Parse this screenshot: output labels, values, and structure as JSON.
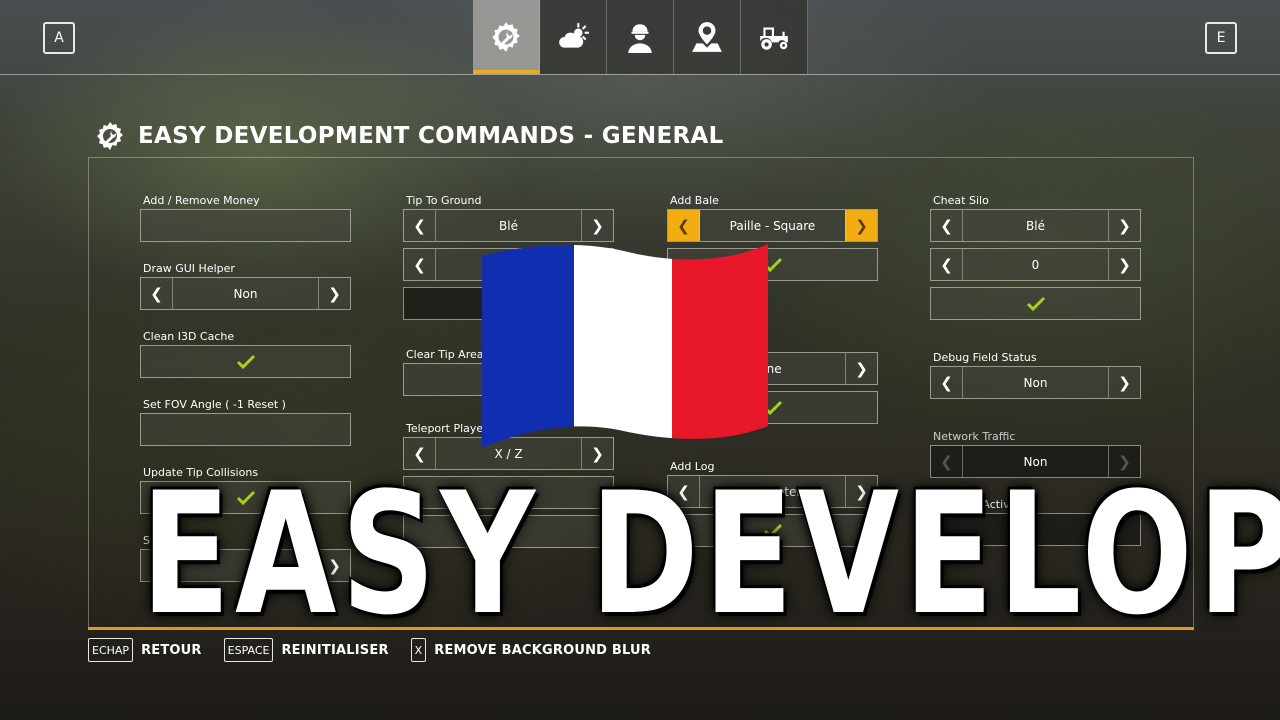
{
  "topbar": {
    "left_key": "A",
    "right_key": "E",
    "tabs": [
      {
        "icon": "wrench-gear-icon",
        "active": true
      },
      {
        "icon": "weather-icon",
        "active": false
      },
      {
        "icon": "farmer-icon",
        "active": false
      },
      {
        "icon": "map-pin-icon",
        "active": false
      },
      {
        "icon": "tractor-icon",
        "active": false
      }
    ]
  },
  "heading": {
    "icon": "wrench-gear-icon",
    "title": "EASY DEVELOPMENT COMMANDS - GENERAL"
  },
  "columns": {
    "c1": {
      "add_money": {
        "label": "Add / Remove Money",
        "value": ""
      },
      "draw_gui": {
        "label": "Draw GUI Helper",
        "value": "Non"
      },
      "clean_i3d": {
        "label": "Clean I3D Cache"
      },
      "fov": {
        "label": "Set FOV Angle ( -1 Reset )",
        "value": ""
      },
      "tip_collisions": {
        "label": "Update Tip Collisions"
      },
      "show_t": {
        "label": "Show T",
        "value": ""
      }
    },
    "c2": {
      "tip_ground": {
        "label": "Tip To Ground",
        "value": "Blé",
        "value2": ""
      },
      "clear_tip": {
        "label": "Clear Tip Area",
        "value": ""
      },
      "teleport": {
        "label": "Teleport Player",
        "value": "X / Z"
      }
    },
    "c3": {
      "add_bale": {
        "label": "Add Bale",
        "value": "Paille - Square"
      },
      "pallet": {
        "value": "ine"
      },
      "add_log": {
        "label": "Add Log",
        "value": "1.0 Meter"
      }
    },
    "c4": {
      "cheat_silo": {
        "label": "Cheat Silo",
        "value": "Blé",
        "amount": "0"
      },
      "debug_field": {
        "label": "Debug Field Status",
        "value": "Non"
      },
      "net_traffic": {
        "label": "Network Traffic",
        "value": "Non"
      },
      "net_activity": {
        "label": "Network Activity"
      }
    }
  },
  "footer": [
    {
      "key": "ECHAP",
      "label": "RETOUR"
    },
    {
      "key": "ESPACE",
      "label": "REINITIALISER"
    },
    {
      "key": "X",
      "label": "REMOVE BACKGROUND BLUR"
    }
  ],
  "overlay": {
    "title": "EASY DEVELOPMENT",
    "flag": "france-flag",
    "flag_colors": {
      "blue": "#0f2fb0",
      "white": "#ffffff",
      "red": "#e8172a"
    }
  },
  "colors": {
    "accent": "#f2ad13",
    "check": "#a6d21c"
  }
}
